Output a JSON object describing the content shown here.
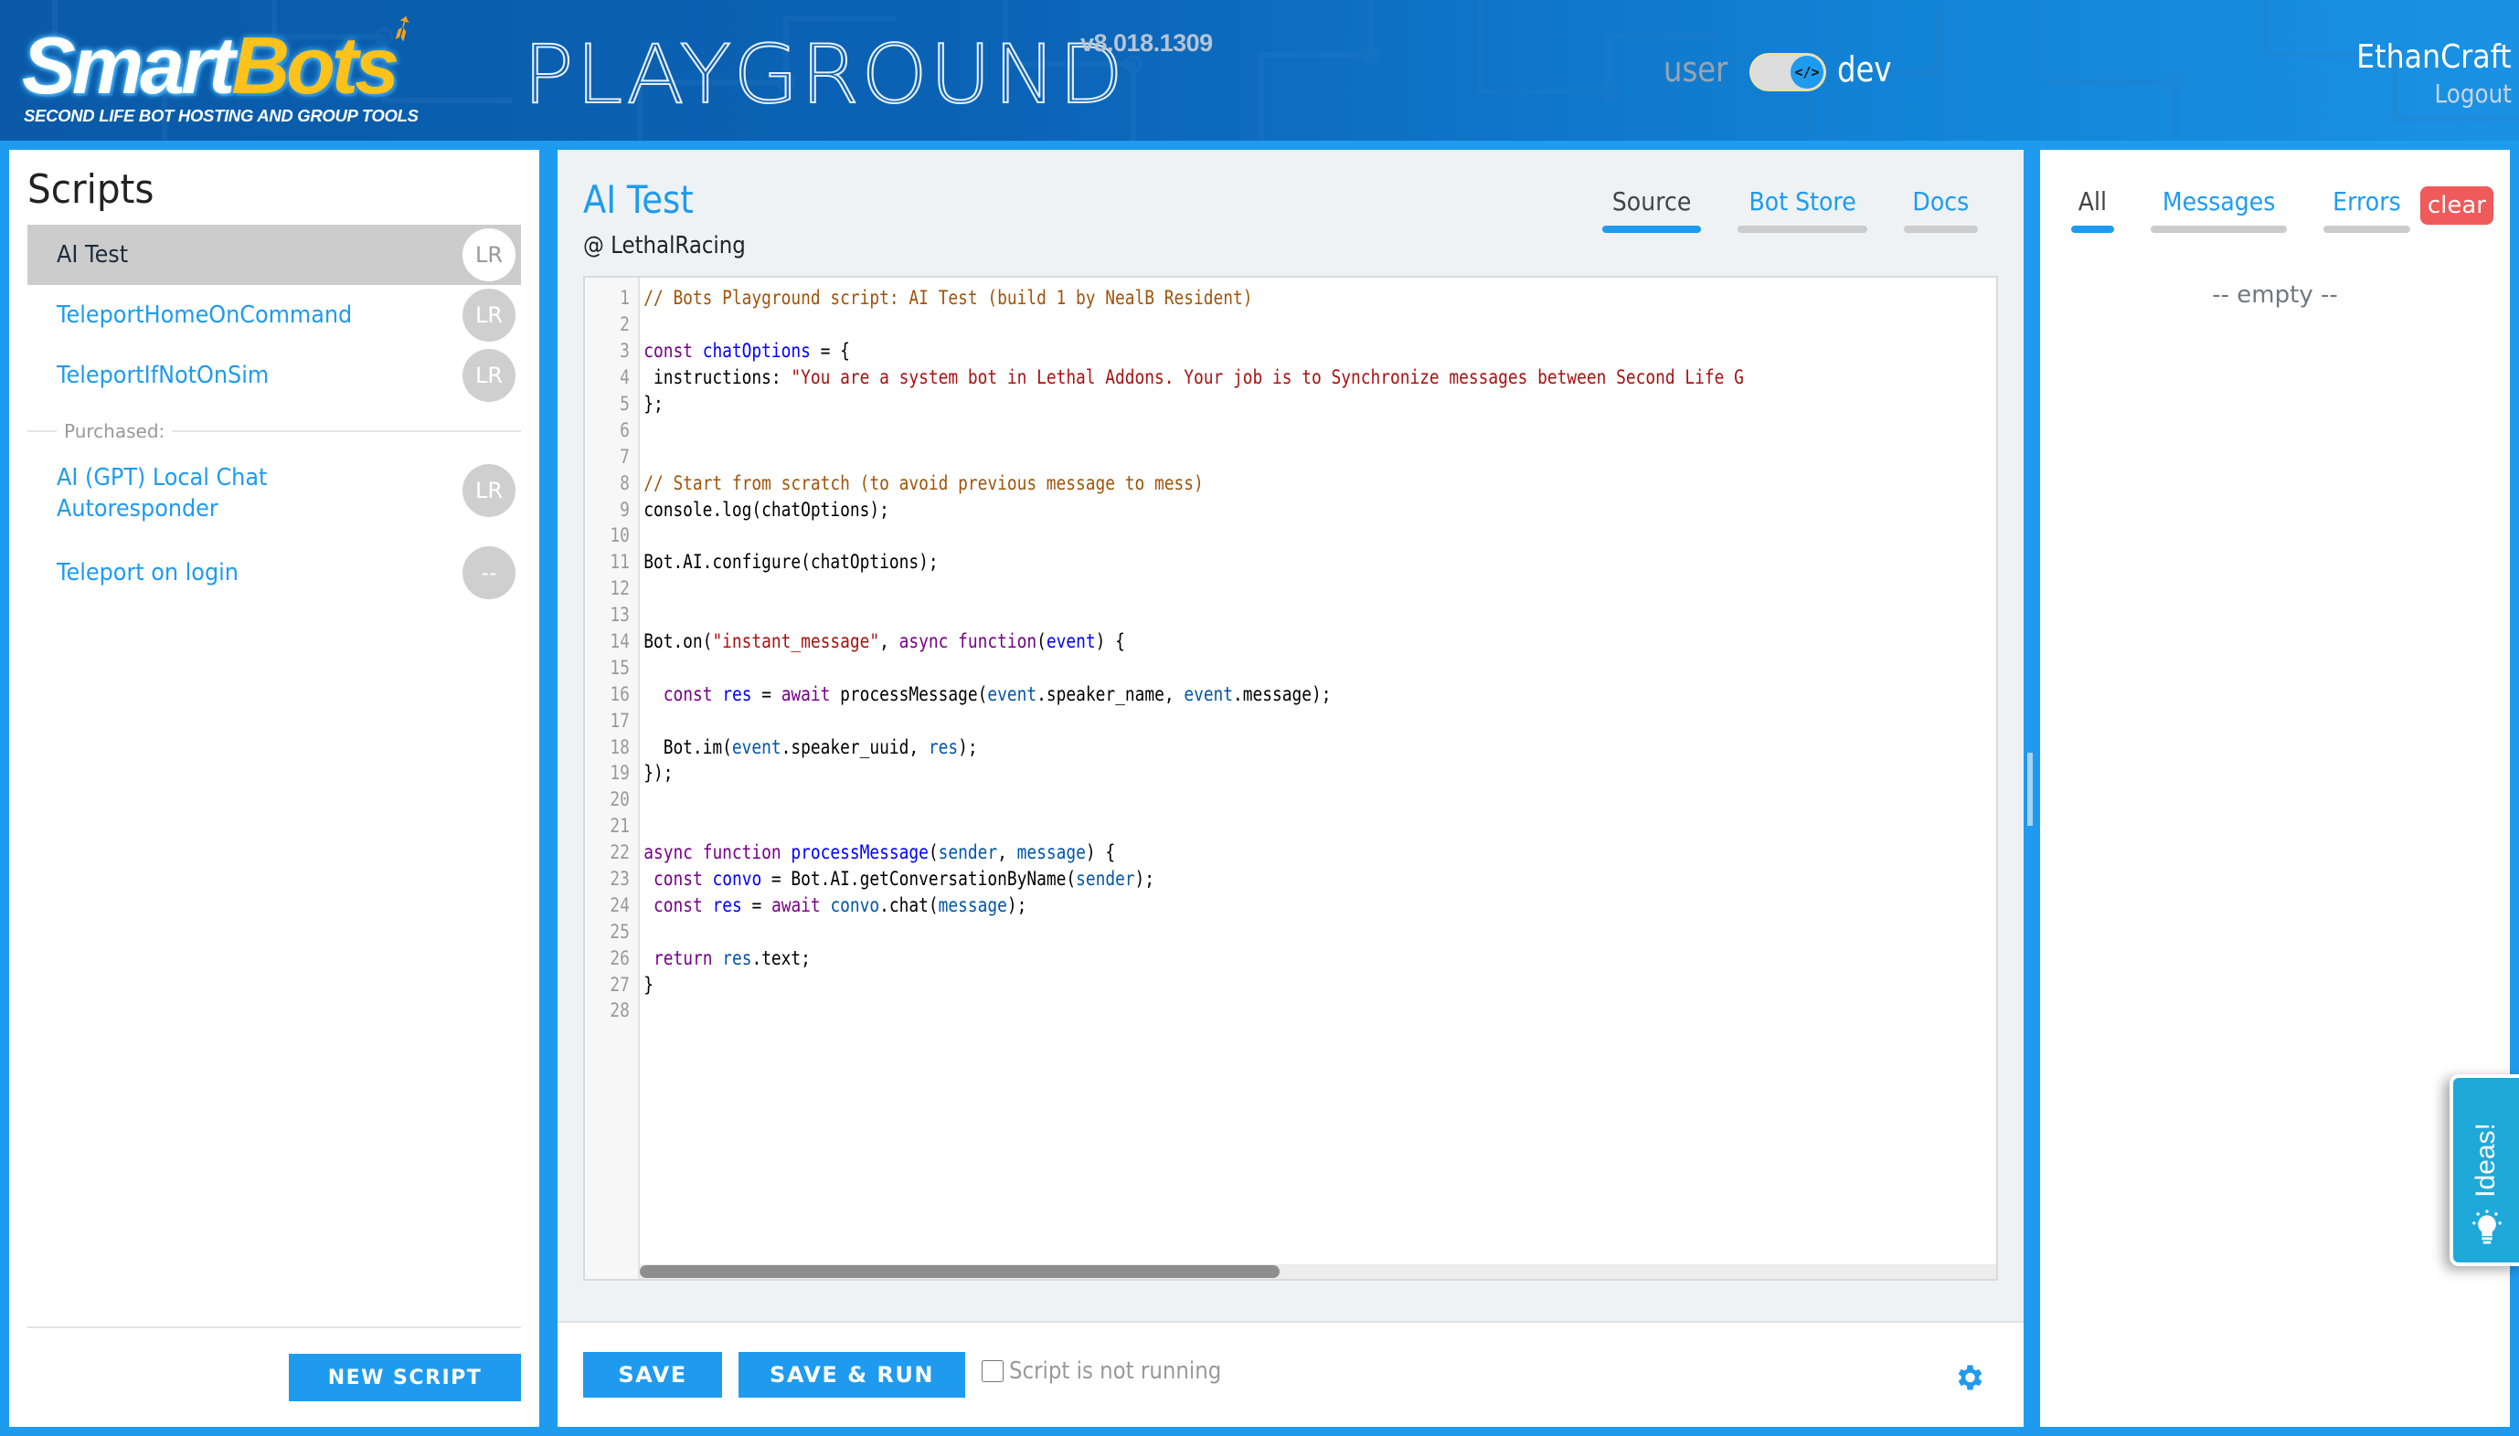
{
  "header": {
    "logo_main": "Smart",
    "logo_accent": "Bots",
    "logo_tagline": "SECOND LIFE BOT HOSTING AND GROUP TOOLS",
    "app_title": "PLAYGROUND",
    "version": "v8.018.1309",
    "mode_left": "user",
    "mode_right": "dev",
    "mode_toggle_icon": "</>",
    "username": "EthanCraft",
    "logout": "Logout"
  },
  "sidebar": {
    "title": "Scripts",
    "scripts": [
      {
        "label": "AI Test",
        "badge": "LR",
        "active": true
      },
      {
        "label": "TeleportHomeOnCommand",
        "badge": "LR"
      },
      {
        "label": "TeleportIfNotOnSim",
        "badge": "LR"
      }
    ],
    "purchased_label": "Purchased:",
    "purchased": [
      {
        "label": "AI (GPT) Local Chat Autoresponder",
        "badge": "LR"
      },
      {
        "label": "Teleport on login",
        "badge": "--"
      }
    ],
    "new_script_label": "NEW SCRIPT"
  },
  "editor": {
    "title": "AI Test",
    "owner": "@ LethalRacing",
    "tabs": [
      {
        "label": "Source",
        "active": true
      },
      {
        "label": "Bot Store"
      },
      {
        "label": "Docs"
      }
    ],
    "code_lines": [
      "// Bots Playground script: AI Test (build 1 by NealB Resident)",
      "",
      "const chatOptions = {",
      " instructions: \"You are a system bot in Lethal Addons. Your job is to Synchronize messages between Second Life G",
      "};",
      "",
      "",
      "// Start from scratch (to avoid previous message to mess)",
      "console.log(chatOptions);",
      "",
      "Bot.AI.configure(chatOptions);",
      "",
      "",
      "Bot.on(\"instant_message\", async function(event) {",
      "",
      "  const res = await processMessage(event.speaker_name, event.message);",
      "",
      "  Bot.im(event.speaker_uuid, res);",
      "});",
      "",
      "",
      "async function processMessage(sender, message) {",
      " const convo = Bot.AI.getConversationByName(sender);",
      " const res = await convo.chat(message);",
      "",
      " return res.text;",
      "}",
      ""
    ],
    "save_label": "SAVE",
    "save_run_label": "SAVE & RUN",
    "run_status": "Script is not running",
    "running": false
  },
  "log": {
    "tabs": [
      {
        "label": "All",
        "active": true
      },
      {
        "label": "Messages"
      },
      {
        "label": "Errors"
      }
    ],
    "clear_label": "clear",
    "empty_text": "-- empty --"
  },
  "ideas": {
    "label": "Ideas!"
  },
  "colors": {
    "accent": "#1e9bef",
    "danger": "#ef5a5a",
    "active_item_bg": "#cccccc"
  }
}
